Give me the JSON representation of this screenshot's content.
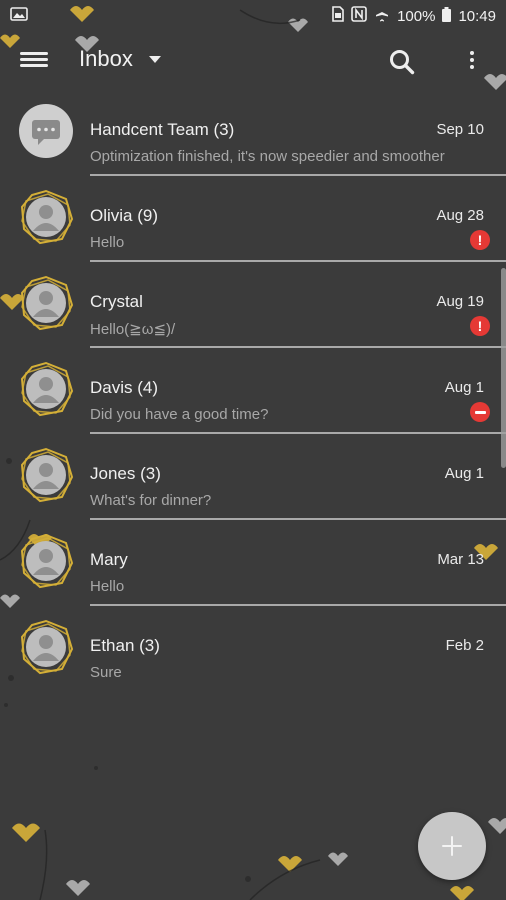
{
  "status_bar": {
    "battery_text": "100%",
    "time": "10:49"
  },
  "app_bar": {
    "title": "Inbox"
  },
  "conversations": [
    {
      "name": "Handcent Team (3)",
      "date": "Sep 10",
      "snippet": "Optimization finished, it's now speedier and smoother",
      "avatar": "chat-icon",
      "status": null
    },
    {
      "name": "Olivia (9)",
      "date": "Aug 28",
      "snippet": "Hello",
      "avatar": "contact-avatar",
      "status": "error"
    },
    {
      "name": "Crystal",
      "date": "Aug 19",
      "snippet": "Hello(≧ω≦)/",
      "avatar": "contact-avatar",
      "status": "error"
    },
    {
      "name": "Davis (4)",
      "date": "Aug 1",
      "snippet": "Did you have a good time?",
      "avatar": "contact-avatar",
      "status": "blocked"
    },
    {
      "name": "Jones (3)",
      "date": "Aug 1",
      "snippet": "What's for dinner?",
      "avatar": "contact-avatar",
      "status": null
    },
    {
      "name": "Mary",
      "date": "Mar 13",
      "snippet": "Hello",
      "avatar": "contact-avatar",
      "status": null
    },
    {
      "name": "Ethan (3)",
      "date": "Feb 2",
      "snippet": "Sure",
      "avatar": "contact-avatar",
      "status": null
    }
  ],
  "colors": {
    "background": "#3b3b3b",
    "accent_gold": "#d4af37",
    "error_red": "#e53935",
    "fab": "#c7c7c7"
  }
}
